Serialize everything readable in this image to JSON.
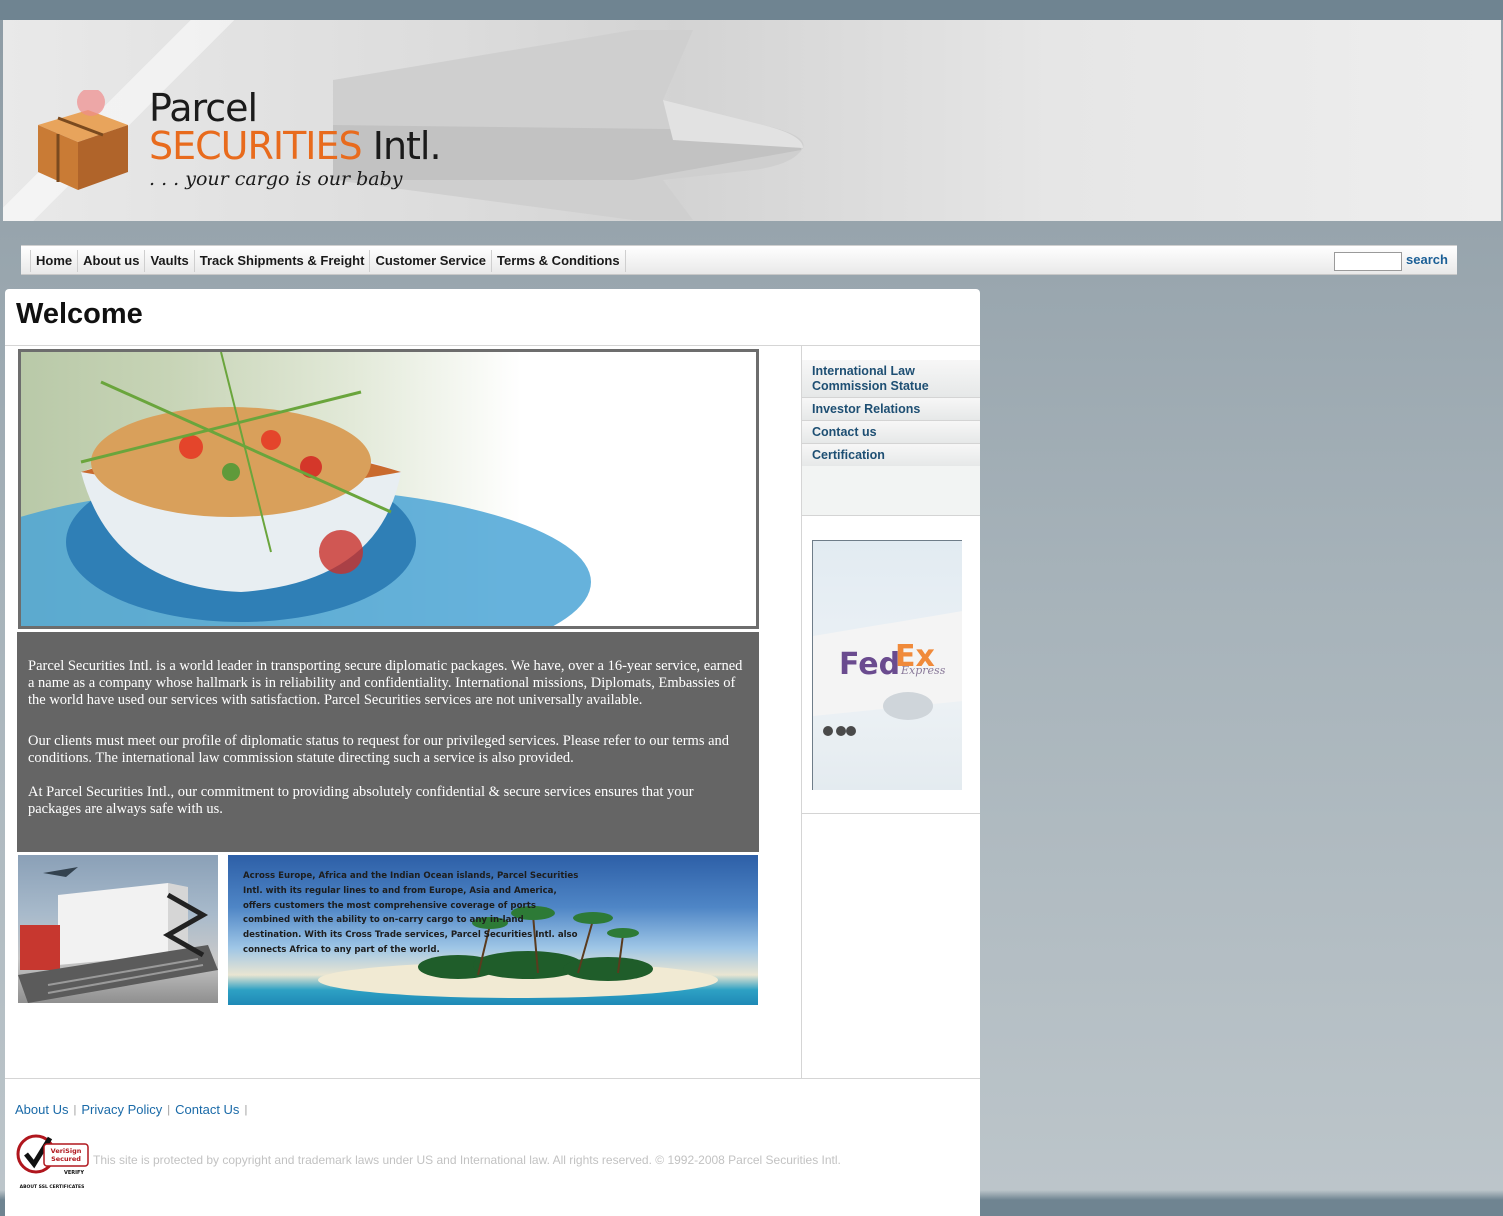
{
  "header": {
    "logo_line1": "Parcel",
    "logo_line2_orange": "SECURITIES",
    "logo_line2_dark": "Intl.",
    "tagline": ". . . your cargo is our baby"
  },
  "nav": {
    "items": [
      "Home",
      "About us",
      "Vaults",
      "Track Shipments & Freight",
      "Customer Service",
      "Terms & Conditions"
    ],
    "search_value": "",
    "search_label": "search"
  },
  "main": {
    "title": "Welcome",
    "paragraphs": [
      "Parcel Securities Intl. is a world leader in transporting secure diplomatic packages. We have, over a 16-year service, earned a name as a company whose hallmark is in reliability and confidentiality. International missions, Diplomats, Embassies of the world have used our services with satisfaction. Parcel Securities services are not universally available.",
      "Our clients must meet our profile of diplomatic status to request for our privileged services. Please refer to our terms and conditions. The international law commission statute directing such a service is also provided.",
      "At Parcel Securities Intl., our commitment to providing absolutely confidential & secure services ensures that your packages are always safe with us."
    ],
    "beach_text": "Across Europe, Africa and the Indian Ocean islands, Parcel Securities Intl. with its regular lines to and from Europe, Asia and America, offers customers the most comprehensive coverage of ports combined with the ability to on-carry cargo to any in-land destination. With its Cross Trade services, Parcel Securities Intl. also connects Africa to any part of the world."
  },
  "sidebar": {
    "links": [
      "International Law Commission Statue",
      "Investor Relations",
      "Contact us",
      "Certification"
    ],
    "fedex_logo_fed": "Fed",
    "fedex_logo_ex": "Ex",
    "fedex_logo_sub": "Express"
  },
  "footer": {
    "links": [
      "About Us",
      "Privacy Policy",
      "Contact Us"
    ],
    "verisign_line1": "VeriSign",
    "verisign_line2": "Secured",
    "verisign_line3": "VERIFY",
    "verisign_caption": "ABOUT SSL CERTIFICATES",
    "copyright": "This site is protected by copyright and trademark laws under US and International law. All rights reserved. © 1992-2008 Parcel Securities Intl."
  },
  "colors": {
    "accent_orange": "#e86b1d",
    "link_blue": "#1a6aa8",
    "sidebar_link": "#1e4f73",
    "textbox_bg": "#656565"
  }
}
